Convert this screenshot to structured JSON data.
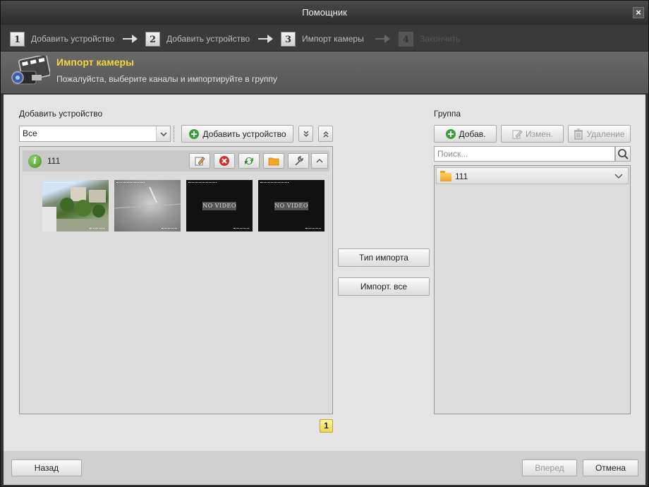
{
  "window": {
    "title": "Помощник",
    "close": "×"
  },
  "steps": [
    {
      "num": "1",
      "label": "Добавить устройство"
    },
    {
      "num": "2",
      "label": "Добавить устройство"
    },
    {
      "num": "3",
      "label": "Импорт камеры"
    },
    {
      "num": "4",
      "label": "Закончить"
    }
  ],
  "header": {
    "title": "Импорт камеры",
    "subtitle": "Пожалуйста, выберите каналы и импортируйте в группу"
  },
  "left": {
    "label": "Добавить устройство",
    "filter_value": "Все",
    "add_device_label": "Добавить устройство",
    "device": {
      "name": "111"
    },
    "thumbnails": [
      {
        "kind": "video"
      },
      {
        "kind": "video-dark"
      },
      {
        "kind": "no-video",
        "text": "NO VIDEO"
      },
      {
        "kind": "no-video",
        "text": "NO VIDEO"
      }
    ],
    "page": "1"
  },
  "middle": {
    "import_type_label": "Тип импорта",
    "import_all_label": "Импорт. все"
  },
  "right": {
    "label": "Группа",
    "add_label": "Добав.",
    "edit_label": "Измен.",
    "delete_label": "Удаление",
    "search_placeholder": "Поиск...",
    "group_name": "111"
  },
  "footer": {
    "back_label": "Назад",
    "next_label": "Вперед",
    "cancel_label": "Отмена"
  },
  "colors": {
    "accent_title": "#f5d53d",
    "page_badge": "#e8d84a",
    "add_icon": "#3aa13a",
    "delete_icon": "#d03030"
  }
}
